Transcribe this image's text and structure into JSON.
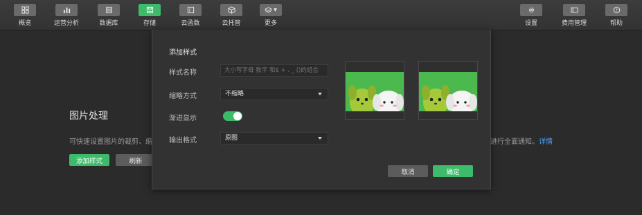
{
  "toolbar": {
    "left_items": [
      {
        "label": "概览",
        "icon": "grid-icon"
      },
      {
        "label": "运营分析",
        "icon": "bar-chart-icon"
      },
      {
        "label": "数据库",
        "icon": "database-icon"
      },
      {
        "label": "存储",
        "icon": "storage-icon",
        "active": true
      },
      {
        "label": "云函数",
        "icon": "function-icon"
      },
      {
        "label": "云托管",
        "icon": "cube-icon"
      },
      {
        "label": "更多",
        "icon": "layers-icon"
      }
    ],
    "right_items": [
      {
        "label": "设置",
        "icon": "gear-icon"
      },
      {
        "label": "费用管理",
        "icon": "card-icon"
      },
      {
        "label": "帮助",
        "icon": "help-icon"
      }
    ]
  },
  "page": {
    "title": "图片处理",
    "desc_left": "可快速设置图片的裁剪、缩",
    "desc_right": "进行全面通知。",
    "desc_link": "详情",
    "add_button": "添加样式",
    "refresh_button": "刷新"
  },
  "modal": {
    "title": "添加样式",
    "name_label": "样式名称",
    "name_placeholder": "大小写字母 数字 和$ + . _ ()的组合",
    "thumb_label": "缩略方式",
    "thumb_value": "不缩略",
    "progressive_label": "渐进显示",
    "progressive_on": true,
    "format_label": "输出格式",
    "format_value": "原图",
    "cancel_button": "取消",
    "confirm_button": "确定"
  },
  "colors": {
    "accent": "#3dbb6a",
    "link": "#4da3ff",
    "background": "#2b2b2b",
    "modal": "#323232"
  }
}
